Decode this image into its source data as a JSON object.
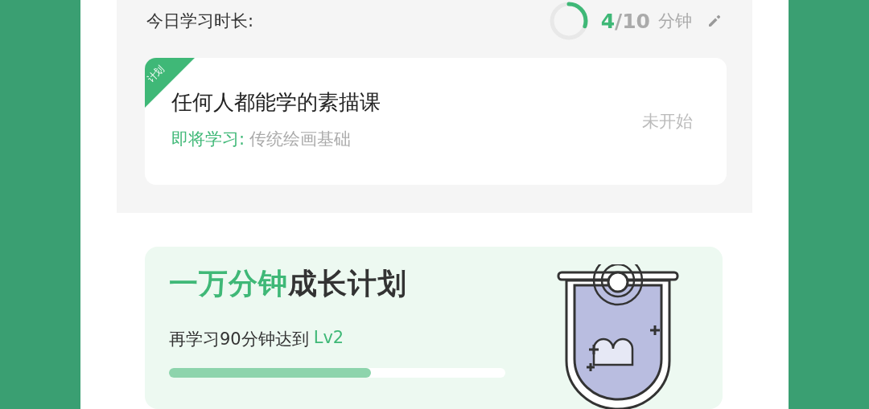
{
  "today": {
    "label": "今日学习时长:",
    "current": "4",
    "total": "/10",
    "unit": "分钟"
  },
  "plan_card": {
    "badge": "计划",
    "title": "任何人都能学的素描课",
    "next_label": "即将学习:",
    "next_lesson": "传统绘画基础",
    "status": "未开始"
  },
  "growth": {
    "title_highlight": "一万分钟",
    "title_rest": "成长计划",
    "message": "再学习90分钟达到",
    "target_level": "Lv2",
    "level": 0.6
  }
}
